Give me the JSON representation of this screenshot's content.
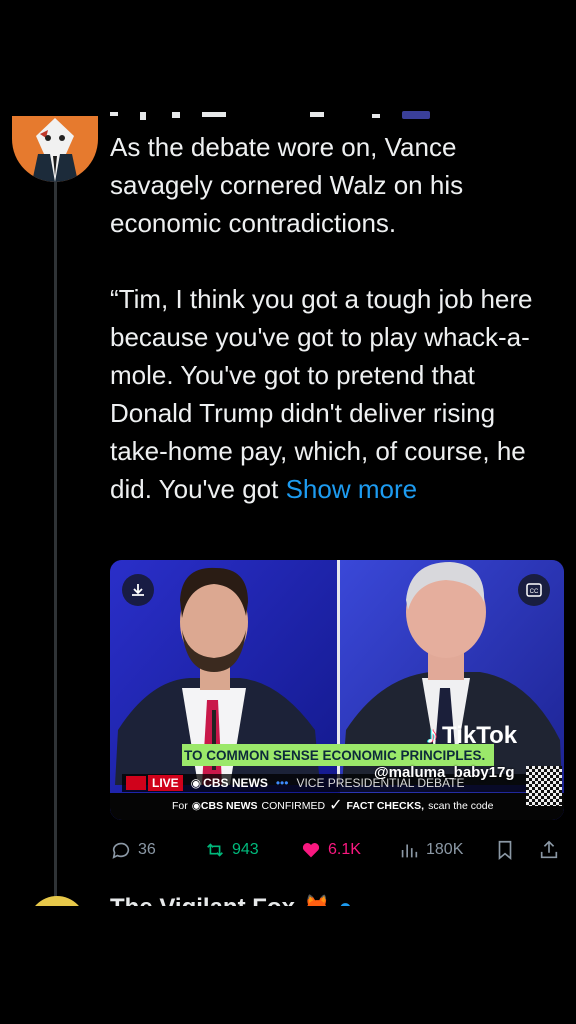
{
  "tweet": {
    "body": "As the debate wore on, Vance savagely cornered Walz on his economic contradictions.\n\n“Tim, I think you got a tough job here because you've got to play whack-a-mole. You've got to pretend that Donald Trump didn't deliver rising take-home pay, which, of course, he did. You've got ",
    "show_more": "Show more"
  },
  "video": {
    "chyron": "TO COMMON SENSE ECONOMIC PRINCIPLES.",
    "live_label": "LIVE",
    "network": "CBS NEWS",
    "program": "VICE PRESIDENTIAL DEBATE",
    "footer_prefix": "For",
    "footer_network": "CBS NEWS",
    "footer_confirmed": "CONFIRMED",
    "footer_factchecks": "FACT CHECKS,",
    "footer_scan": "scan the code",
    "watermark_brand": "TikTok",
    "watermark_user": "@maluma_baby17g"
  },
  "actions": {
    "replies": "36",
    "reposts": "943",
    "likes": "6.1K",
    "views": "180K"
  },
  "next_tweet": {
    "author": "The Vigilant Fox"
  },
  "colors": {
    "accent": "#1d9bf0",
    "like": "#f91880",
    "repost": "#00ba7c",
    "chyron_bg": "#9be86a"
  }
}
